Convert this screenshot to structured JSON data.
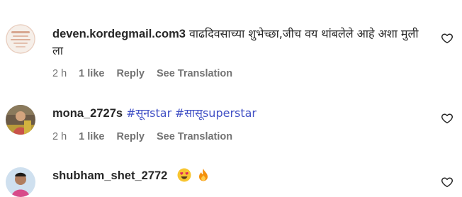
{
  "comments": [
    {
      "username": "deven.kordegmail.com3",
      "text": "वाढदिवसाच्या शुभेच्छा,जीच वय थांबलेले आहे अशा मुली ला",
      "time": "2 h",
      "likes": "1 like",
      "reply": "Reply",
      "translate": "See Translation"
    },
    {
      "username": "mona_2727s",
      "hashtags": [
        "#सूनstar",
        "#सासूsuperstar"
      ],
      "time": "2 h",
      "likes": "1 like",
      "reply": "Reply",
      "translate": "See Translation"
    },
    {
      "username": "shubham_shet_2772",
      "emojis": [
        "heart-eyes-emoji",
        "fire-emoji"
      ]
    }
  ],
  "colors": {
    "hashtag": "#4150c5",
    "meta": "#737373",
    "text": "#262626"
  }
}
